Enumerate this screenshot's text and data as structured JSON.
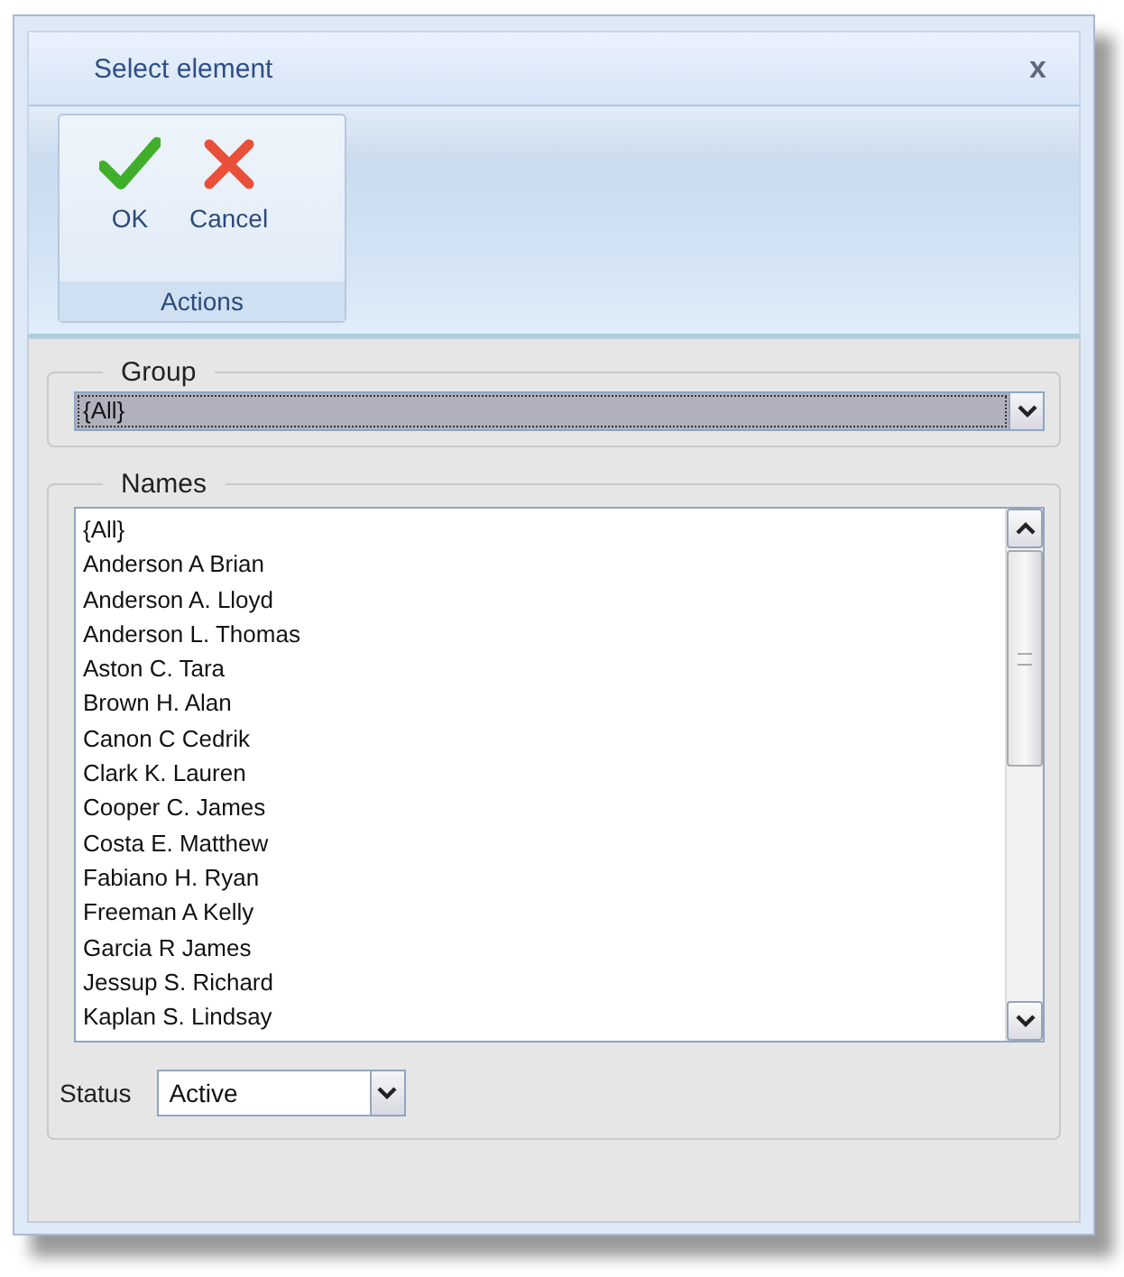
{
  "window": {
    "title": "Select element",
    "close": "x"
  },
  "ribbon": {
    "group_label": "Actions",
    "buttons": [
      {
        "kind": "ok",
        "label": "OK"
      },
      {
        "kind": "cancel",
        "label": "Cancel"
      }
    ]
  },
  "group": {
    "legend": "Group",
    "value": "{All}",
    "focused": true
  },
  "names": {
    "legend": "Names",
    "items": [
      "{All}",
      "Anderson A Brian",
      "Anderson A. Lloyd",
      "Anderson L. Thomas",
      "Aston C. Tara",
      "Brown H. Alan",
      "Canon C Cedrik",
      "Clark K. Lauren",
      "Cooper C. James",
      "Costa E. Matthew",
      "Fabiano H. Ryan",
      "Freeman A Kelly",
      "Garcia R James",
      "Jessup S. Richard",
      "Kaplan S. Lindsay"
    ]
  },
  "status": {
    "label": "Status",
    "value": "Active",
    "focused": false
  }
}
